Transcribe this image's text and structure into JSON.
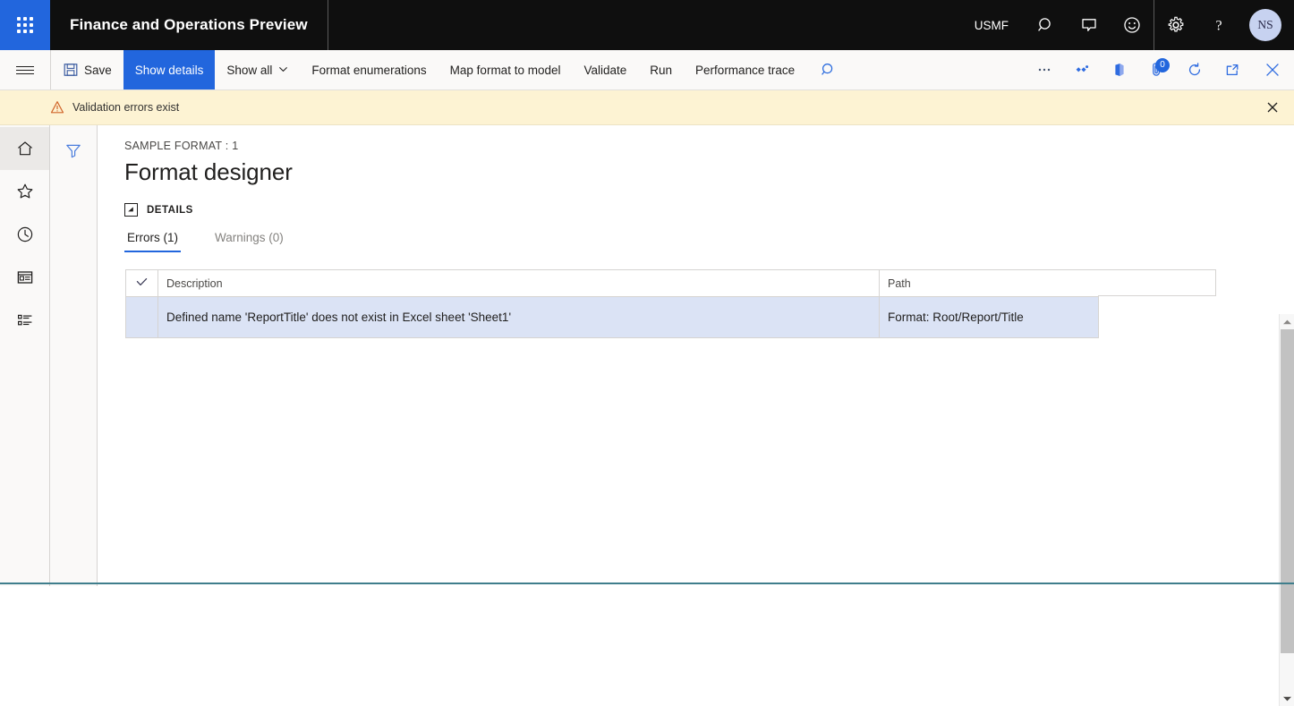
{
  "topbar": {
    "waffle_name": "app-launcher",
    "app_title": "Finance and Operations Preview",
    "company": "USMF",
    "search_icon": "search-icon",
    "feedback_icon": "message-icon",
    "smiley_icon": "smiley-icon",
    "settings_icon": "gear-icon",
    "help_icon": "help-icon",
    "avatar_initials": "NS",
    "brand_color": "#2266dd",
    "bar_color": "#0f0f0f"
  },
  "toolbar": {
    "menu_icon": "hamburger-icon",
    "save_label": "Save",
    "show_details_label": "Show details",
    "show_all_label": "Show all",
    "format_enumerations_label": "Format enumerations",
    "map_format_label": "Map format to model",
    "validate_label": "Validate",
    "run_label": "Run",
    "performance_trace_label": "Performance trace",
    "search_icon": "search-icon",
    "overflow_icon": "ellipsis-icon",
    "share_icon": "share-diamond-icon",
    "office_icon": "office-apps-icon",
    "attachments_icon": "attachments-icon",
    "attachments_count": "0",
    "refresh_icon": "refresh-icon",
    "popout_icon": "open-in-new-window-icon",
    "close_icon": "close-icon",
    "active_button": "Show details"
  },
  "message_bar": {
    "icon": "warning-triangle-icon",
    "text": "Validation errors exist",
    "close_icon": "close-icon",
    "background": "#fdf3d3"
  },
  "nav_rail": {
    "items": [
      {
        "name": "home",
        "icon": "home-icon",
        "selected": true
      },
      {
        "name": "favorites",
        "icon": "star-icon",
        "selected": false
      },
      {
        "name": "recent",
        "icon": "clock-icon",
        "selected": false
      },
      {
        "name": "workspaces",
        "icon": "workspace-icon",
        "selected": false
      },
      {
        "name": "modules",
        "icon": "list-icon",
        "selected": false
      }
    ]
  },
  "filter_rail": {
    "filter_icon": "filter-funnel-icon"
  },
  "page": {
    "breadcrumb": "SAMPLE FORMAT : 1",
    "title": "Format designer",
    "details_section_label": "DETAILS",
    "collapse_icon": "collapse-triangle-icon"
  },
  "tabs": [
    {
      "label": "Errors (1)",
      "active": true
    },
    {
      "label": "Warnings (0)",
      "active": false
    }
  ],
  "grid": {
    "select_all_icon": "checkmark-icon",
    "columns": [
      "Description",
      "Path"
    ],
    "rows": [
      {
        "description": "Defined name 'ReportTitle' does not exist in Excel sheet 'Sheet1'",
        "path": "Format: Root/Report/Title",
        "selected": true
      }
    ],
    "selected_row_color": "#dbe3f5"
  },
  "scrollbar": {
    "up_icon": "chevron-up-icon",
    "down_icon": "chevron-down-icon"
  }
}
